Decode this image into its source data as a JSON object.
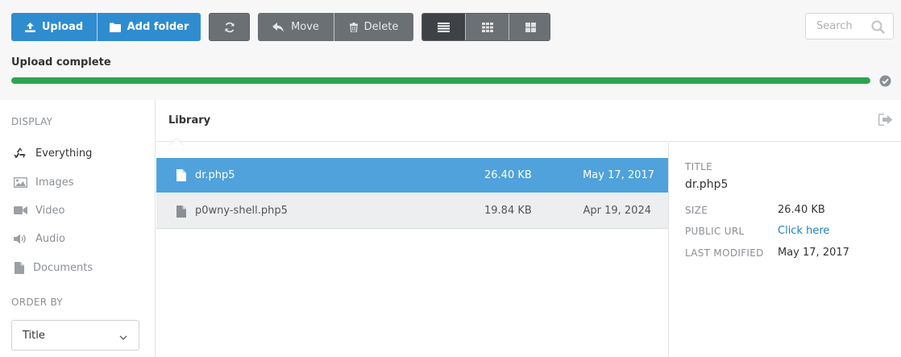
{
  "toolbar": {
    "upload_label": "Upload",
    "add_folder_label": "Add folder",
    "move_label": "Move",
    "delete_label": "Delete",
    "refresh_icon": "refresh-icon",
    "view_modes": [
      "list-view",
      "grid-view",
      "tiles-view"
    ],
    "active_view": "list-view"
  },
  "search": {
    "placeholder": "Search",
    "value": ""
  },
  "upload_status": {
    "label": "Upload complete",
    "progress_percent": 100,
    "color": "#2ea44f"
  },
  "sidebar": {
    "display_heading": "DISPLAY",
    "items": [
      {
        "label": "Everything",
        "icon": "recycle-icon",
        "active": true
      },
      {
        "label": "Images",
        "icon": "image-icon",
        "active": false
      },
      {
        "label": "Video",
        "icon": "video-camera-icon",
        "active": false
      },
      {
        "label": "Audio",
        "icon": "speaker-icon",
        "active": false
      },
      {
        "label": "Documents",
        "icon": "document-icon",
        "active": false
      }
    ],
    "order_heading": "ORDER BY",
    "order_value": "Title"
  },
  "library": {
    "title": "Library",
    "files": [
      {
        "name": "dr.php5",
        "size": "26.40 KB",
        "modified": "May 17, 2017",
        "selected": true
      },
      {
        "name": "p0wny-shell.php5",
        "size": "19.84 KB",
        "modified": "Apr 19, 2024",
        "selected": false
      }
    ]
  },
  "details": {
    "title_label": "TITLE",
    "title_value": "dr.php5",
    "size_label": "SIZE",
    "size_value": "26.40 KB",
    "url_label": "PUBLIC URL",
    "url_value": "Click here",
    "modified_label": "LAST MODIFIED",
    "modified_value": "May 17, 2017"
  },
  "colors": {
    "primary": "#2f8ccf",
    "selected_row": "#4fa2dc",
    "toolbar_gray": "#6b7075",
    "link": "#1f7fc4"
  }
}
